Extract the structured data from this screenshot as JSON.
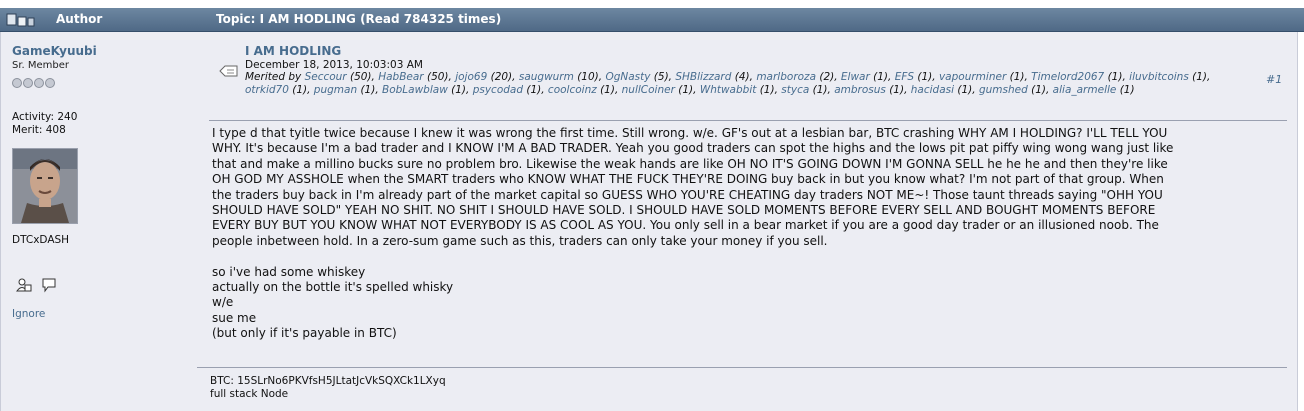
{
  "header": {
    "author_label": "Author",
    "topic_text": "Topic: I AM HODLING  (Read 784325 times)",
    "icon": "topic-icon"
  },
  "author": {
    "name": "GameKyuubi",
    "rank": "Sr. Member",
    "activity": "Activity: 240",
    "merit": "Merit: 408",
    "signature_name": "DTCxDASH",
    "profile_icon": "profile-icon",
    "message_icon": "message-icon",
    "ignore_label": "Ignore"
  },
  "post": {
    "subject": "I AM HODLING",
    "date": "December 18, 2013, 10:03:03 AM",
    "number": "#1",
    "merited_label": "Merited by",
    "merits": [
      {
        "name": "Seccour",
        "count": "(50)"
      },
      {
        "name": "HabBear",
        "count": "(50)"
      },
      {
        "name": "jojo69",
        "count": "(20)"
      },
      {
        "name": "saugwurm",
        "count": "(10)"
      },
      {
        "name": "OgNasty",
        "count": "(5)"
      },
      {
        "name": "SHBlizzard",
        "count": "(4)"
      },
      {
        "name": "marlboroza",
        "count": "(2)"
      },
      {
        "name": "Elwar",
        "count": "(1)"
      },
      {
        "name": "EFS",
        "count": "(1)"
      },
      {
        "name": "vapourminer",
        "count": "(1)"
      },
      {
        "name": "Timelord2067",
        "count": "(1)"
      },
      {
        "name": "iluvbitcoins",
        "count": "(1)"
      },
      {
        "name": "otrkid70",
        "count": "(1)"
      },
      {
        "name": "pugman",
        "count": "(1)"
      },
      {
        "name": "BobLawblaw",
        "count": "(1)"
      },
      {
        "name": "psycodad",
        "count": "(1)"
      },
      {
        "name": "coolcoinz",
        "count": "(1)"
      },
      {
        "name": "nullCoiner",
        "count": "(1)"
      },
      {
        "name": "Whtwabbit",
        "count": "(1)"
      },
      {
        "name": "styca",
        "count": "(1)"
      },
      {
        "name": "ambrosus",
        "count": "(1)"
      },
      {
        "name": "hacidasi",
        "count": "(1)"
      },
      {
        "name": "gumshed",
        "count": "(1)"
      },
      {
        "name": "alia_armelle",
        "count": "(1)"
      }
    ],
    "body_lines": [
      "I type d that tyitle twice because I knew it was wrong the first time.  Still wrong.  w/e.  GF's out at a lesbian bar, BTC crashing WHY AM I HOLDING? I'LL TELL YOU",
      "WHY.  It's because I'm a bad trader and I KNOW I'M A BAD TRADER.  Yeah you good traders can spot the highs and the lows pit pat piffy wing wong wang just like",
      "that and make a millino bucks sure no problem bro.  Likewise the weak hands are like OH NO IT'S GOING DOWN I'M GONNA SELL he he he and then they're like",
      "OH GOD MY ASSHOLE when the SMART traders who KNOW WHAT THE FUCK THEY'RE DOING buy back in but you know what?  I'm not part of that group.  When",
      "the traders buy back in I'm already part of the market capital so GUESS WHO YOU'RE CHEATING day traders NOT ME~!  Those taunt threads saying \"OHH YOU",
      "SHOULD HAVE SOLD\" YEAH NO SHIT.  NO SHIT I SHOULD HAVE SOLD.  I SHOULD HAVE SOLD MOMENTS BEFORE EVERY SELL AND BOUGHT MOMENTS BEFORE",
      "EVERY BUY BUT YOU KNOW WHAT NOT EVERYBODY IS AS COOL AS YOU.  You only sell in a bear market if you are a good day trader or an illusioned noob.  The",
      "people inbetween hold.  In a zero-sum game such as this, traders can only take your money if you sell.",
      "",
      "so i've had some whiskey",
      "actually on the bottle it's spelled whisky",
      "w/e",
      "sue me",
      "(but only if it's payable in BTC)"
    ],
    "signature_lines": [
      "BTC: 15SLrNo6PKVfsH5JLtatJcVkSQXCk1LXyq",
      "full stack Node"
    ]
  },
  "colors": {
    "header_bg": "#5b7693",
    "post_bg": "#ecedf3",
    "link": "#476c8e"
  }
}
